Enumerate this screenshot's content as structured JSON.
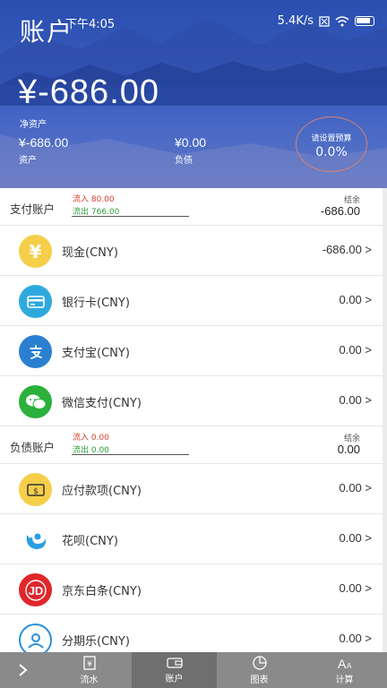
{
  "status_bar": {
    "time": "下午4:05",
    "network_speed": "5.4K/s"
  },
  "header": {
    "title": "账户",
    "net_worth": "¥-686.00",
    "net_worth_label": "净资产",
    "assets_value": "¥-686.00",
    "assets_label": "资产",
    "liabilities_value": "¥0.00",
    "liabilities_label": "负债",
    "budget_hint": "请设置预算",
    "budget_percent": "0.0%"
  },
  "payment_section": {
    "title": "支付账户",
    "inflow": "流入  80.00",
    "outflow": "流出  766.00",
    "balance_label": "结余",
    "balance": "-686.00",
    "accounts": [
      {
        "name": "现金(CNY)",
        "amount": "-686.00 >",
        "icon": "yen-icon",
        "color": "#f5cf4a"
      },
      {
        "name": "银行卡(CNY)",
        "amount": "0.00 >",
        "icon": "bank-card-icon",
        "color": "#2ea9dd"
      },
      {
        "name": "支付宝(CNY)",
        "amount": "0.00 >",
        "icon": "alipay-icon",
        "color": "#2a7fd1"
      },
      {
        "name": "微信支付(CNY)",
        "amount": "0.00 >",
        "icon": "wechat-icon",
        "color": "#2bb13b"
      }
    ]
  },
  "debt_section": {
    "title": "负债账户",
    "inflow": "流入  0.00",
    "outflow": "流出  0.00",
    "balance_label": "结余",
    "balance": "0.00",
    "accounts": [
      {
        "name": "应付款项(CNY)",
        "amount": "0.00 >",
        "icon": "payable-icon",
        "color": "#f5cf4a"
      },
      {
        "name": "花呗(CNY)",
        "amount": "0.00 >",
        "icon": "huabei-icon",
        "color": "#2a9ee0"
      },
      {
        "name": "京东白条(CNY)",
        "amount": "0.00 >",
        "icon": "jd-icon",
        "color": "#e0262b"
      },
      {
        "name": "分期乐(CNY)",
        "amount": "0.00 >",
        "icon": "fenqile-icon",
        "color": "#2a8fd8"
      }
    ]
  },
  "bottom_nav": {
    "tabs": [
      {
        "label": "流水",
        "icon": "ledger-icon"
      },
      {
        "label": "账户",
        "icon": "wallet-icon"
      },
      {
        "label": "图表",
        "icon": "pie-chart-icon"
      },
      {
        "label": "计算",
        "icon": "calculator-icon"
      }
    ],
    "active_tab": "账户"
  }
}
